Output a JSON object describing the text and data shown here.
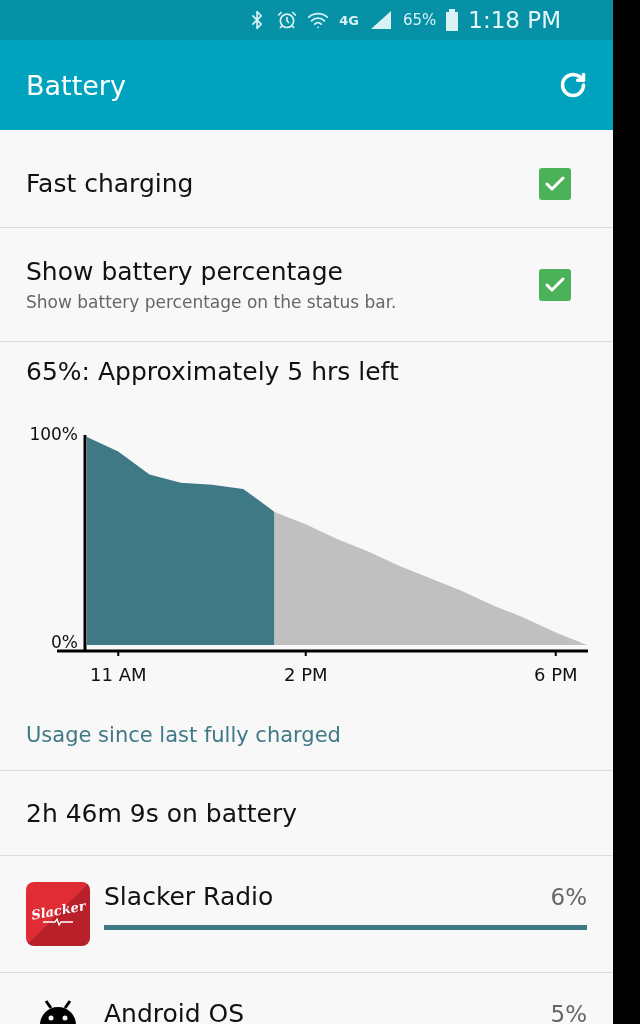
{
  "status_bar": {
    "network": "4G",
    "battery_percent": "65%",
    "time": "1:18 PM"
  },
  "app_bar": {
    "title": "Battery"
  },
  "settings": [
    {
      "title": "Fast charging",
      "checked": true
    },
    {
      "title": "Show battery percentage",
      "subtitle": "Show battery percentage on the status bar.",
      "checked": true
    }
  ],
  "estimate": "65%: Approximately 5 hrs left",
  "chart_data": {
    "type": "area",
    "categories": [
      null,
      "11 AM",
      null,
      null,
      null,
      null,
      null,
      "2 PM",
      null,
      null,
      null,
      null,
      null,
      null,
      null,
      "6 PM",
      null
    ],
    "series": [
      {
        "color": "#3f7986",
        "values": [
          100,
          93,
          82,
          78,
          77,
          75,
          64,
          null,
          null,
          null,
          null,
          null,
          null,
          null,
          null,
          null,
          null
        ]
      },
      {
        "color": "#c0c0c0",
        "values": [
          null,
          null,
          null,
          null,
          null,
          null,
          64,
          58,
          51,
          45,
          38,
          32,
          26,
          19,
          13,
          6,
          0
        ]
      }
    ],
    "ylim": [
      0,
      100
    ],
    "yticks": [
      {
        "value": 0,
        "label": "0%"
      },
      {
        "value": 100,
        "label": "100%"
      }
    ]
  },
  "usage_link": "Usage since last fully charged",
  "on_battery": "2h 46m 9s on battery",
  "apps": [
    {
      "name": "Slacker Radio",
      "percent": "6%",
      "level": 1,
      "kind": "slacker",
      "logo_text": "Slacker"
    },
    {
      "name": "Android OS",
      "percent": "5%",
      "kind": "android"
    }
  ]
}
